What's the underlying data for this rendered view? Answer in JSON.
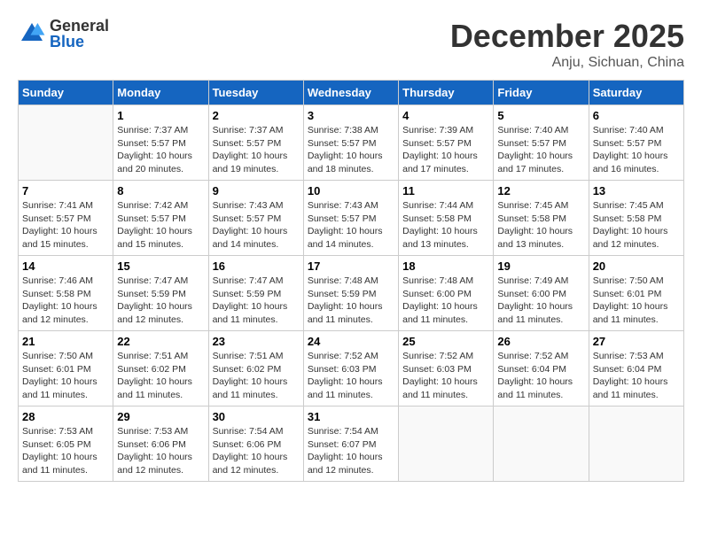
{
  "header": {
    "logo_general": "General",
    "logo_blue": "Blue",
    "month": "December 2025",
    "location": "Anju, Sichuan, China"
  },
  "columns": [
    "Sunday",
    "Monday",
    "Tuesday",
    "Wednesday",
    "Thursday",
    "Friday",
    "Saturday"
  ],
  "weeks": [
    [
      {
        "day": "",
        "info": ""
      },
      {
        "day": "1",
        "info": "Sunrise: 7:37 AM\nSunset: 5:57 PM\nDaylight: 10 hours\nand 20 minutes."
      },
      {
        "day": "2",
        "info": "Sunrise: 7:37 AM\nSunset: 5:57 PM\nDaylight: 10 hours\nand 19 minutes."
      },
      {
        "day": "3",
        "info": "Sunrise: 7:38 AM\nSunset: 5:57 PM\nDaylight: 10 hours\nand 18 minutes."
      },
      {
        "day": "4",
        "info": "Sunrise: 7:39 AM\nSunset: 5:57 PM\nDaylight: 10 hours\nand 17 minutes."
      },
      {
        "day": "5",
        "info": "Sunrise: 7:40 AM\nSunset: 5:57 PM\nDaylight: 10 hours\nand 17 minutes."
      },
      {
        "day": "6",
        "info": "Sunrise: 7:40 AM\nSunset: 5:57 PM\nDaylight: 10 hours\nand 16 minutes."
      }
    ],
    [
      {
        "day": "7",
        "info": "Sunrise: 7:41 AM\nSunset: 5:57 PM\nDaylight: 10 hours\nand 15 minutes."
      },
      {
        "day": "8",
        "info": "Sunrise: 7:42 AM\nSunset: 5:57 PM\nDaylight: 10 hours\nand 15 minutes."
      },
      {
        "day": "9",
        "info": "Sunrise: 7:43 AM\nSunset: 5:57 PM\nDaylight: 10 hours\nand 14 minutes."
      },
      {
        "day": "10",
        "info": "Sunrise: 7:43 AM\nSunset: 5:57 PM\nDaylight: 10 hours\nand 14 minutes."
      },
      {
        "day": "11",
        "info": "Sunrise: 7:44 AM\nSunset: 5:58 PM\nDaylight: 10 hours\nand 13 minutes."
      },
      {
        "day": "12",
        "info": "Sunrise: 7:45 AM\nSunset: 5:58 PM\nDaylight: 10 hours\nand 13 minutes."
      },
      {
        "day": "13",
        "info": "Sunrise: 7:45 AM\nSunset: 5:58 PM\nDaylight: 10 hours\nand 12 minutes."
      }
    ],
    [
      {
        "day": "14",
        "info": "Sunrise: 7:46 AM\nSunset: 5:58 PM\nDaylight: 10 hours\nand 12 minutes."
      },
      {
        "day": "15",
        "info": "Sunrise: 7:47 AM\nSunset: 5:59 PM\nDaylight: 10 hours\nand 12 minutes."
      },
      {
        "day": "16",
        "info": "Sunrise: 7:47 AM\nSunset: 5:59 PM\nDaylight: 10 hours\nand 11 minutes."
      },
      {
        "day": "17",
        "info": "Sunrise: 7:48 AM\nSunset: 5:59 PM\nDaylight: 10 hours\nand 11 minutes."
      },
      {
        "day": "18",
        "info": "Sunrise: 7:48 AM\nSunset: 6:00 PM\nDaylight: 10 hours\nand 11 minutes."
      },
      {
        "day": "19",
        "info": "Sunrise: 7:49 AM\nSunset: 6:00 PM\nDaylight: 10 hours\nand 11 minutes."
      },
      {
        "day": "20",
        "info": "Sunrise: 7:50 AM\nSunset: 6:01 PM\nDaylight: 10 hours\nand 11 minutes."
      }
    ],
    [
      {
        "day": "21",
        "info": "Sunrise: 7:50 AM\nSunset: 6:01 PM\nDaylight: 10 hours\nand 11 minutes."
      },
      {
        "day": "22",
        "info": "Sunrise: 7:51 AM\nSunset: 6:02 PM\nDaylight: 10 hours\nand 11 minutes."
      },
      {
        "day": "23",
        "info": "Sunrise: 7:51 AM\nSunset: 6:02 PM\nDaylight: 10 hours\nand 11 minutes."
      },
      {
        "day": "24",
        "info": "Sunrise: 7:52 AM\nSunset: 6:03 PM\nDaylight: 10 hours\nand 11 minutes."
      },
      {
        "day": "25",
        "info": "Sunrise: 7:52 AM\nSunset: 6:03 PM\nDaylight: 10 hours\nand 11 minutes."
      },
      {
        "day": "26",
        "info": "Sunrise: 7:52 AM\nSunset: 6:04 PM\nDaylight: 10 hours\nand 11 minutes."
      },
      {
        "day": "27",
        "info": "Sunrise: 7:53 AM\nSunset: 6:04 PM\nDaylight: 10 hours\nand 11 minutes."
      }
    ],
    [
      {
        "day": "28",
        "info": "Sunrise: 7:53 AM\nSunset: 6:05 PM\nDaylight: 10 hours\nand 11 minutes."
      },
      {
        "day": "29",
        "info": "Sunrise: 7:53 AM\nSunset: 6:06 PM\nDaylight: 10 hours\nand 12 minutes."
      },
      {
        "day": "30",
        "info": "Sunrise: 7:54 AM\nSunset: 6:06 PM\nDaylight: 10 hours\nand 12 minutes."
      },
      {
        "day": "31",
        "info": "Sunrise: 7:54 AM\nSunset: 6:07 PM\nDaylight: 10 hours\nand 12 minutes."
      },
      {
        "day": "",
        "info": ""
      },
      {
        "day": "",
        "info": ""
      },
      {
        "day": "",
        "info": ""
      }
    ]
  ]
}
